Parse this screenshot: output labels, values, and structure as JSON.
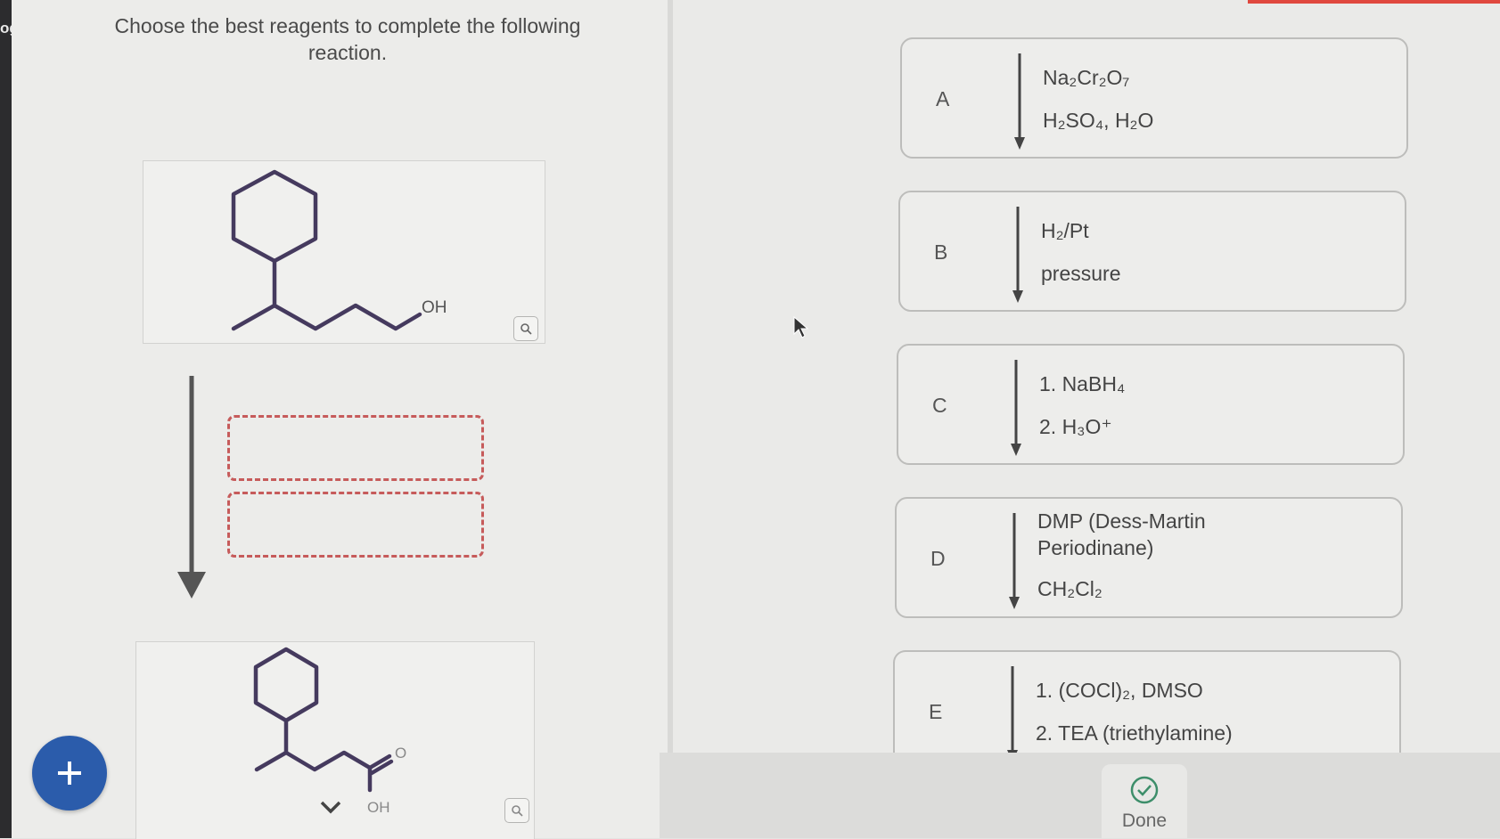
{
  "left_edge": {
    "label": "og"
  },
  "question": {
    "text": "Choose the best reagents to complete the following reaction."
  },
  "starting_material": {
    "oh_label": "OH"
  },
  "product": {
    "o_label": "O",
    "oh_label": "OH"
  },
  "options": [
    {
      "letter": "A",
      "line1": "Na₂Cr₂O₇",
      "line2": "H₂SO₄, H₂O"
    },
    {
      "letter": "B",
      "line1": "H₂/Pt",
      "line2": "pressure"
    },
    {
      "letter": "C",
      "line1": "1. NaBH₄",
      "line2": "2. H₃O⁺"
    },
    {
      "letter": "D",
      "line1": "DMP (Dess-Martin Periodinane)",
      "line2": "CH₂Cl₂"
    },
    {
      "letter": "E",
      "line1": "1. (COCl)₂, DMSO",
      "line2": "2. TEA (triethylamine)"
    }
  ],
  "done": {
    "label": "Done"
  },
  "colors": {
    "accent": "#2b5cab",
    "molecule": "#453a5e",
    "slot_border": "#c65b5b",
    "top_bar": "#e0483e"
  },
  "icons": {
    "add": "plus-icon",
    "zoom": "magnifier-icon",
    "done": "check-circle-icon",
    "cursor": "mouse-pointer-icon",
    "chevron": "chevron-down-icon"
  }
}
